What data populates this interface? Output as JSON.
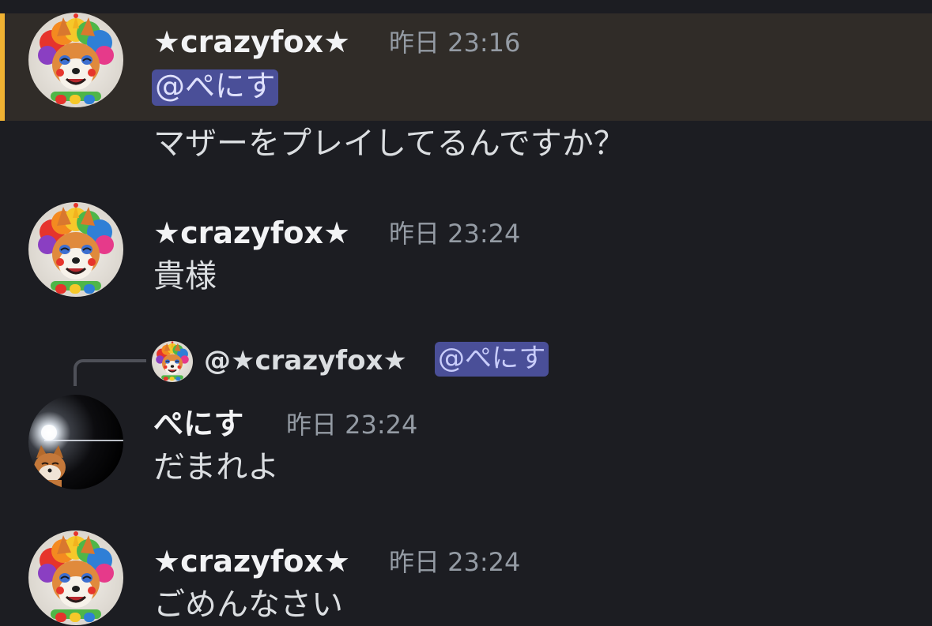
{
  "colors": {
    "background": "#1c1d22",
    "highlight_background": "#302c28",
    "highlight_bar": "#f0b232",
    "mention_background": "#4a4f98",
    "username": "#f2f3f5",
    "timestamp": "#949ba4",
    "message_text": "#dbdee1"
  },
  "messages": [
    {
      "author": "★crazyfox★",
      "timestamp": "昨日 23:16",
      "mention": "@ぺにす",
      "text": "マザーをプレイしてるんですか？",
      "highlighted": true,
      "avatar_icon": "clown-fox-avatar"
    },
    {
      "author": "★crazyfox★",
      "timestamp": "昨日 23:24",
      "text": "貴様",
      "avatar_icon": "clown-fox-avatar"
    },
    {
      "reply": {
        "author": "@★crazyfox★",
        "mention": "@ぺにす",
        "avatar_icon": "clown-fox-avatar"
      },
      "author": "ぺにす",
      "timestamp": "昨日 23:24",
      "text": "だまれよ",
      "avatar_icon": "fox-lens-flare-avatar"
    },
    {
      "author": "★crazyfox★",
      "timestamp": "昨日 23:24",
      "text": "ごめんなさい",
      "avatar_icon": "clown-fox-avatar"
    }
  ]
}
